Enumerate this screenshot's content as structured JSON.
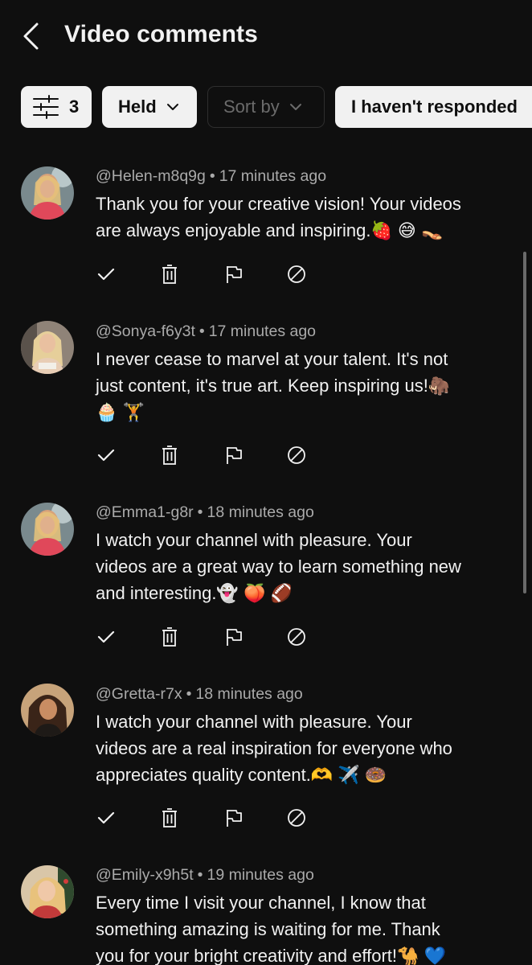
{
  "header": {
    "title": "Video comments"
  },
  "chips": {
    "filter_count": "3",
    "held_label": "Held",
    "sort_label": "Sort by",
    "responded_label": "I haven't responded"
  },
  "comments": [
    {
      "handle": "@Helen-m8q9g",
      "time": "17 minutes ago",
      "lines": [
        "Thank you for your creative vision! Your videos",
        "are always enjoyable and inspiring.🍓 😅 👡"
      ]
    },
    {
      "handle": "@Sonya-f6y3t",
      "time": "17 minutes ago",
      "lines": [
        "I never cease to marvel at your talent. It's not",
        "just content, it's true art. Keep inspiring us!🦣",
        "🧁 🏋️"
      ]
    },
    {
      "handle": "@Emma1-g8r",
      "time": "18 minutes ago",
      "lines": [
        "I watch your channel with pleasure. Your",
        "videos are a great way to learn something new",
        "and interesting.👻 🍑 🏈"
      ]
    },
    {
      "handle": "@Gretta-r7x",
      "time": "18 minutes ago",
      "lines": [
        "I watch your channel with pleasure. Your",
        "videos are a real inspiration for everyone who",
        "appreciates quality content.🫶 ✈️ 🍩"
      ]
    },
    {
      "handle": "@Emily-x9h5t",
      "time": "19 minutes ago",
      "lines": [
        "Every time I visit your channel, I know that",
        "something amazing is waiting for me. Thank",
        "you for your bright creativity and effort!🐪 💙"
      ]
    }
  ],
  "colors": {
    "background": "#0f0f0f",
    "primary_text": "#f1f1f1",
    "secondary_text": "#aaaaaa",
    "chip_light": "#f1f1f1"
  },
  "icons": {
    "back": "chevron-left-icon",
    "filter": "sliders-icon",
    "approve": "check-icon",
    "remove": "trash-icon",
    "report": "flag-icon",
    "hide_user": "block-icon"
  }
}
